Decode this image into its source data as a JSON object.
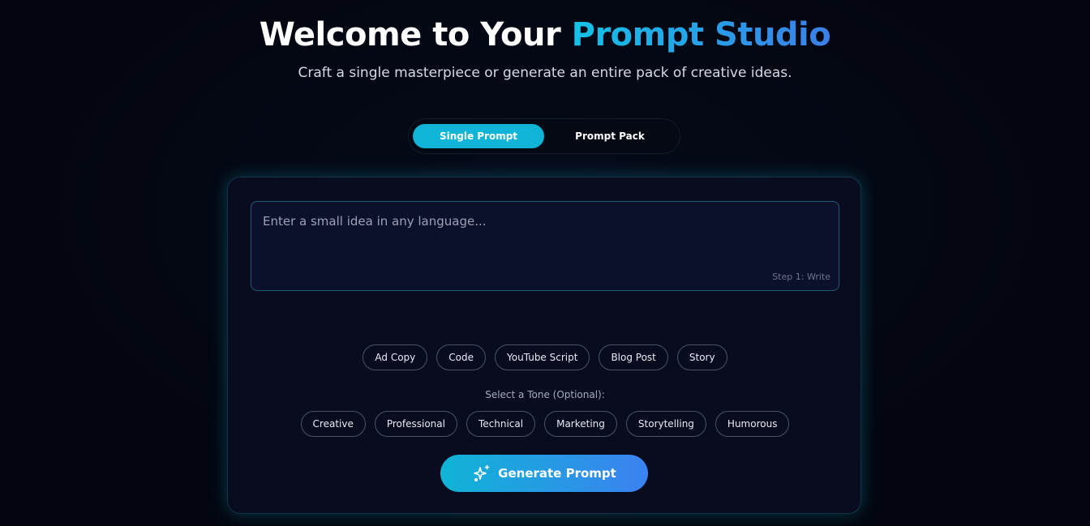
{
  "hero": {
    "title_main": "Welcome to Your ",
    "title_accent": "Prompt Studio",
    "subtitle": "Craft a single masterpiece or generate an entire pack of creative ideas."
  },
  "mode_tabs": [
    {
      "label": "Single Prompt",
      "active": true
    },
    {
      "label": "Prompt Pack",
      "active": false
    }
  ],
  "idea_input": {
    "value": "",
    "placeholder": "Enter a small idea in any language...",
    "step_hint": "Step 1: Write"
  },
  "content_types": [
    "Ad Copy",
    "Code",
    "YouTube Script",
    "Blog Post",
    "Story"
  ],
  "tone": {
    "label": "Select a Tone (Optional):",
    "options": [
      "Creative",
      "Professional",
      "Technical",
      "Marketing",
      "Storytelling",
      "Humorous"
    ]
  },
  "generate": {
    "label": "Generate Prompt",
    "icon": "sparkles-icon"
  },
  "colors": {
    "accent": "#0fb4d6",
    "accent_end": "#3b82f0",
    "background": "#03060f",
    "card": "#080c1e"
  }
}
